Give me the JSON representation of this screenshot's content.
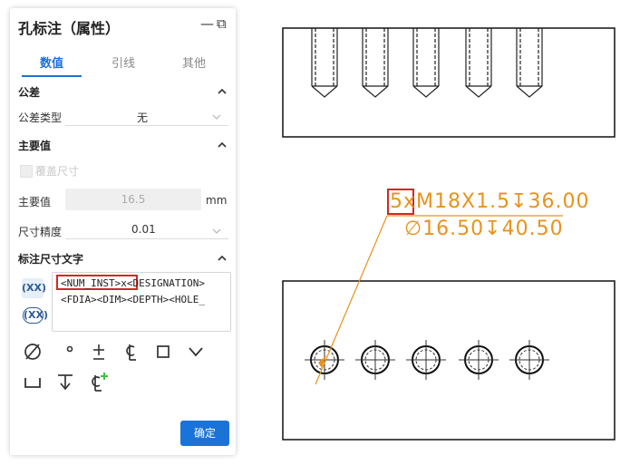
{
  "panel": {
    "title": "孔标注（属性）",
    "minimize": "—",
    "restore": "⧉",
    "tabs": [
      {
        "label": "数值",
        "active": true
      },
      {
        "label": "引线",
        "active": false
      },
      {
        "label": "其他",
        "active": false
      }
    ],
    "tolerance": {
      "section": "公差",
      "type_label": "公差类型",
      "type_value": "无"
    },
    "main_value": {
      "section": "主要值",
      "override_label": "覆盖尺寸",
      "value_label": "主要值",
      "value": "16.5",
      "unit": "mm",
      "precision_label": "尺寸精度",
      "precision_value": "0.01"
    },
    "dim_text": {
      "section": "标注尺寸文字",
      "xx1": "(XX)",
      "xx2": "(XX)",
      "line1_highlight": "<NUM_INST>x",
      "line1_rest": "<DESIGNATION>",
      "line2": "<FDIA><DIM><DEPTH><HOLE_"
    },
    "symbols": [
      {
        "name": "diameter-symbol",
        "glyph": "∅"
      },
      {
        "name": "degree-symbol",
        "glyph": "°"
      },
      {
        "name": "plus-minus-symbol",
        "glyph": "±"
      },
      {
        "name": "centerline-symbol",
        "glyph": "℄"
      },
      {
        "name": "square-symbol",
        "glyph": "□"
      },
      {
        "name": "countersink-symbol",
        "glyph": "⌵"
      },
      {
        "name": "counterbore-symbol",
        "glyph": "⌴"
      },
      {
        "name": "depth-symbol",
        "glyph": "↧"
      },
      {
        "name": "add-centerline-symbol",
        "glyph": "℄+"
      }
    ],
    "ok_label": "确定"
  },
  "drawing": {
    "callout_line1_count": "5",
    "callout_line1_x": "x",
    "callout_line1_rest": "M18X1.5↧36.00",
    "callout_line2": "∅16.50↧40.50",
    "annotation_color": "#e8921c",
    "highlight_color": "#d32727"
  },
  "colors": {
    "accent": "#1a73d9"
  }
}
